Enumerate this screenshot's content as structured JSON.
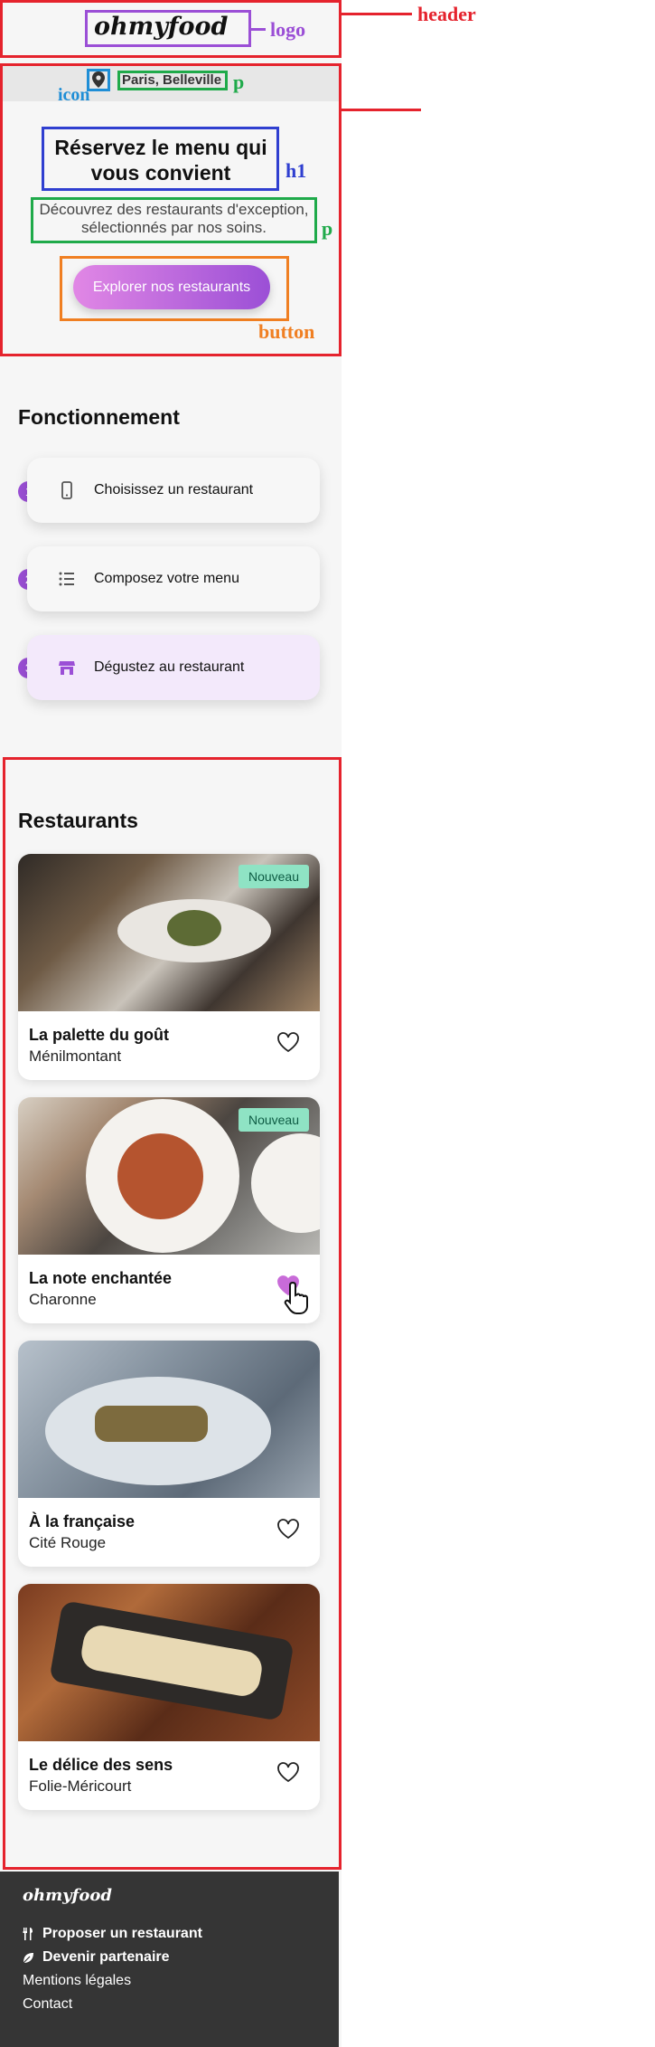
{
  "header": {
    "logo": "ohmyfood",
    "annotation_logo": "logo",
    "annotation_header": "header"
  },
  "hero": {
    "location": "Paris, Belleville",
    "title": "Réservez le menu qui vous convient",
    "subtitle": "Découvrez des restaurants d'exception, sélectionnés par nos soins.",
    "cta": "Explorer nos restaurants",
    "annotations": {
      "icon": "icon",
      "p1": "p",
      "h1": "h1",
      "p2": "p",
      "button": "button"
    }
  },
  "how": {
    "title": "Fonctionnement",
    "steps": [
      {
        "num": "1",
        "label": "Choisissez un restaurant",
        "icon": "mobile-phone-icon"
      },
      {
        "num": "2",
        "label": "Composez votre menu",
        "icon": "list-icon"
      },
      {
        "num": "3",
        "label": "Dégustez au restaurant",
        "icon": "store-icon"
      }
    ]
  },
  "restaurants": {
    "title": "Restaurants",
    "items": [
      {
        "name": "La palette du goût",
        "area": "Ménilmontant",
        "badge": "Nouveau",
        "liked": false
      },
      {
        "name": "La note enchantée",
        "area": "Charonne",
        "badge": "Nouveau",
        "liked": true
      },
      {
        "name": "À la française",
        "area": "Cité Rouge",
        "badge": "",
        "liked": false
      },
      {
        "name": "Le délice des sens",
        "area": "Folie-Méricourt",
        "badge": "",
        "liked": false
      }
    ]
  },
  "footer": {
    "logo": "ohmyfood",
    "links": [
      "Proposer un restaurant",
      "Devenir partenaire",
      "Mentions légales",
      "Contact"
    ]
  },
  "colors": {
    "accent": "#9b4fd6",
    "badge": "#8fe3c4",
    "annotation_red": "#e5232d",
    "footer_bg": "#353535"
  }
}
